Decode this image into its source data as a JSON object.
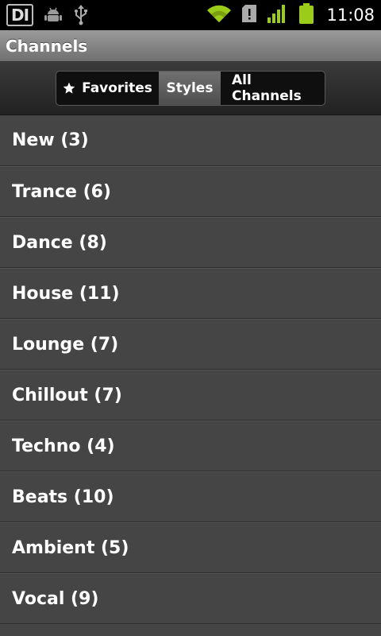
{
  "statusbar": {
    "app_logo": "DI",
    "icons": [
      "android-debug-icon",
      "usb-icon",
      "wifi-icon",
      "sd-card-alert-icon",
      "signal-icon",
      "battery-icon"
    ],
    "time": "11:08"
  },
  "title": "Channels",
  "tabs": [
    {
      "label": "Favorites",
      "icon": "star-icon"
    },
    {
      "label": "Styles",
      "selected": true
    },
    {
      "label": "All Channels"
    }
  ],
  "styles": [
    "New (3)",
    "Trance (6)",
    "Dance (8)",
    "House (11)",
    "Lounge (7)",
    "Chillout (7)",
    "Techno (4)",
    "Beats (10)",
    "Ambient (5)",
    "Vocal (9)"
  ],
  "colors": {
    "accent_green": "#9ccc1a",
    "list_bg": "#454545",
    "selected_tab": "#606060"
  }
}
